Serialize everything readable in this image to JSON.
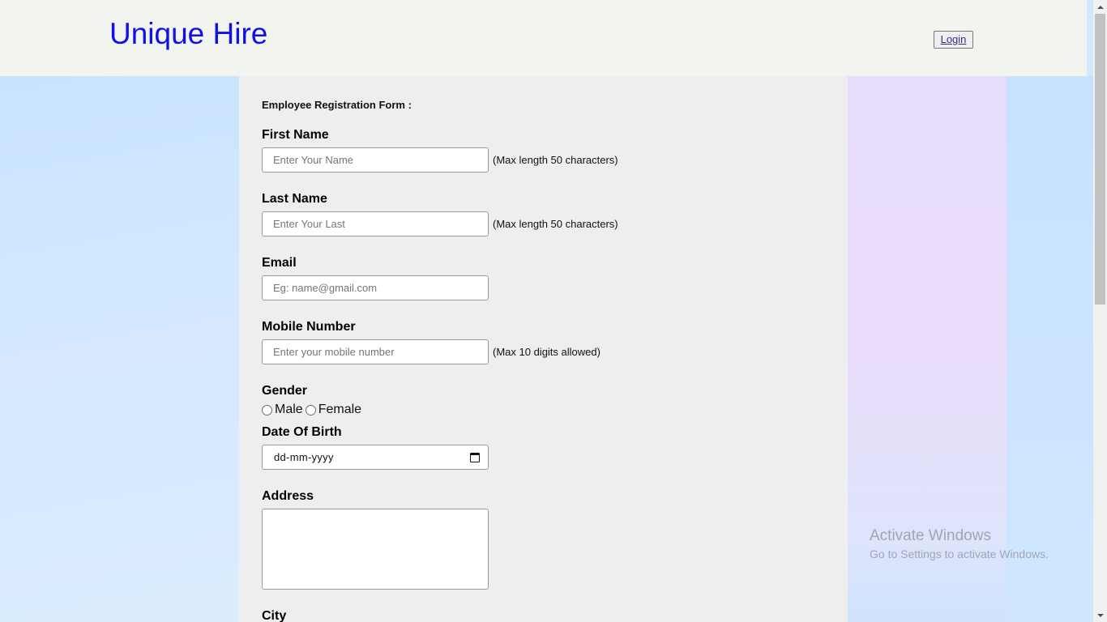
{
  "header": {
    "brand": "Unique Hire",
    "login_label": "Login"
  },
  "form": {
    "title": "Employee Registration Form :",
    "first_name": {
      "label": "First Name",
      "placeholder": "Enter Your Name",
      "value": "",
      "hint": "(Max length 50 characters)"
    },
    "last_name": {
      "label": "Last Name",
      "placeholder": "Enter Your Last",
      "value": "",
      "hint": "(Max length 50 characters)"
    },
    "email": {
      "label": "Email",
      "placeholder": "Eg: name@gmail.com",
      "value": ""
    },
    "mobile": {
      "label": "Mobile Number",
      "placeholder": "Enter your mobile number",
      "value": "",
      "hint": "(Max 10 digits allowed)"
    },
    "gender": {
      "label": "Gender",
      "options": [
        "Male",
        "Female"
      ],
      "selected": null
    },
    "dob": {
      "label": "Date Of Birth",
      "value": "dd-mm-yyyy",
      "icon": "calendar-icon"
    },
    "address": {
      "label": "Address",
      "value": ""
    },
    "city": {
      "label": "City"
    }
  },
  "watermark": {
    "title": "Activate Windows",
    "subtitle": "Go to Settings to activate Windows."
  },
  "colors": {
    "brand": "#1010e8",
    "header_bg": "#f2f4ef",
    "form_bg": "#eeeeee",
    "page_bg": "#cfe4fd",
    "side_band": "#e8dcfb"
  }
}
